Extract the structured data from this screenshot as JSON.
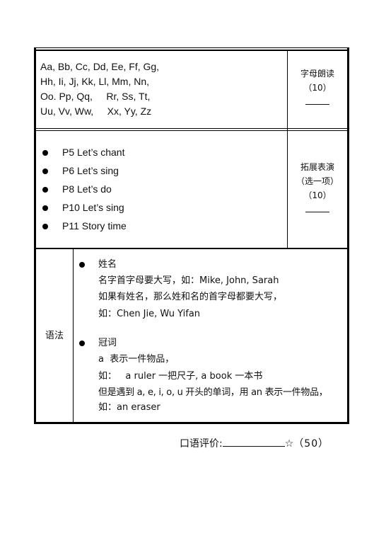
{
  "table": {
    "row1": {
      "alphabet_lines": [
        "Aa, Bb, Cc, Dd, Ee, Ff, Gg,",
        "Hh, Ii, Jj, Kk, Ll, Mm, Nn,",
        "Oo. Pp, Qq,     Rr, Ss, Tt,",
        "Uu, Vv, Ww,     Xx, Yy, Zz"
      ],
      "side": {
        "title": "字母朗读",
        "points": "（10）",
        "blank": ""
      }
    },
    "row2": {
      "items": [
        "P5 Let’s chant",
        "P6 Let’s sing",
        "P8 Let’s do",
        "P10 Let’s sing",
        "P11 Story time"
      ],
      "side": {
        "title": "拓展表演",
        "subtitle": "（选一项）",
        "points": "（10）",
        "blank": ""
      }
    },
    "row3": {
      "label": "语法",
      "sections": [
        {
          "heading": "姓名",
          "lines": [
            "名字首字母要大写，如：Mike, John, Sarah",
            "如果有姓名，那么姓和名的首字母都要大写，",
            "如：Chen Jie, Wu Yifan"
          ]
        },
        {
          "heading": "冠词",
          "lines": [
            "a  表示一件物品，",
            "如：   a ruler 一把尺子, a book 一本书",
            "但是遇到 a, e, i, o, u 开头的单词，用 an 表示一件物品，",
            "如：an eraser"
          ]
        }
      ]
    }
  },
  "footer": {
    "label": "口语评价:",
    "blank": "",
    "star_icon": "☆",
    "points": "（50）"
  }
}
